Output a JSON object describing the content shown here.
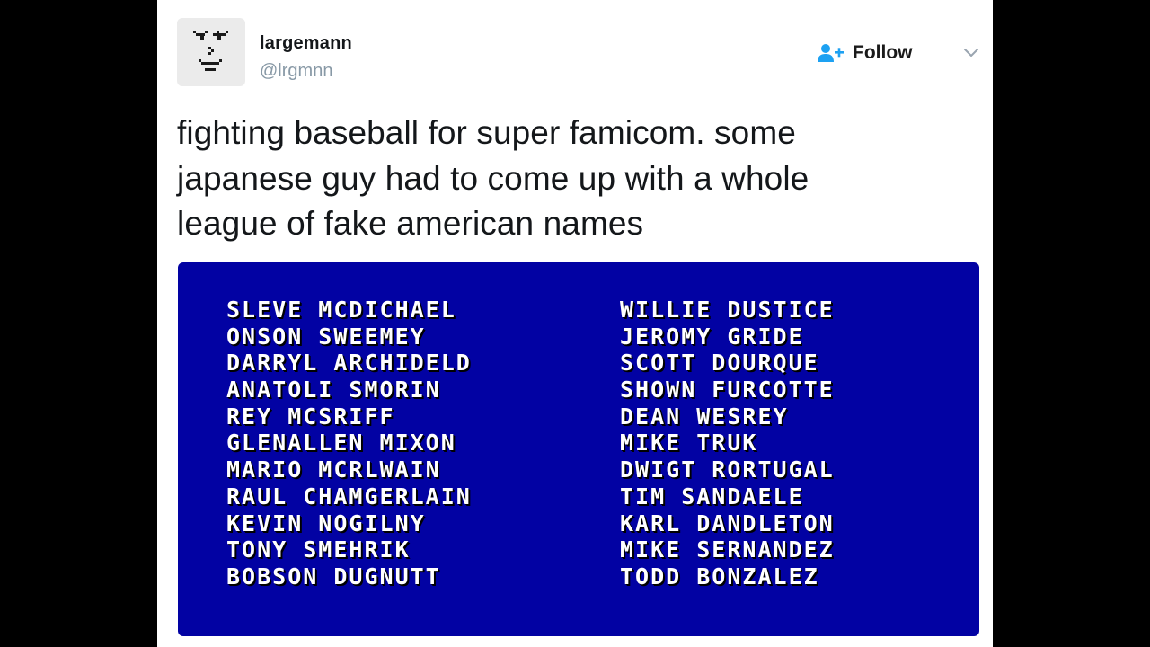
{
  "tweet": {
    "author": {
      "display_name": "largemann",
      "handle": "@lrgmnn",
      "avatar_icon": "pixel-face-avatar"
    },
    "follow_label": "Follow",
    "follow_icon": "add-user-icon",
    "menu_icon": "chevron-down-icon",
    "text": "fighting baseball for super famicom. some\njapanese guy had to come up with a whole\nleague of fake american names"
  },
  "media": {
    "background_color": "#0202a3",
    "left_column": [
      "SLEVE MCDICHAEL",
      "ONSON SWEEMEY",
      "DARRYL ARCHIDELD",
      "ANATOLI SMORIN",
      "REY MCSRIFF",
      "GLENALLEN MIXON",
      "MARIO MCRLWAIN",
      "RAUL CHAMGERLAIN",
      "KEVIN NOGILNY",
      "TONY SMEHRIK",
      "BOBSON DUGNUTT"
    ],
    "right_column": [
      "WILLIE DUSTICE",
      "JEROMY GRIDE",
      "SCOTT DOURQUE",
      "SHOWN FURCOTTE",
      "DEAN WESREY",
      "MIKE TRUK",
      "DWIGT RORTUGAL",
      "TIM SANDAELE",
      "KARL DANDLETON",
      "MIKE SERNANDEZ",
      "TODD BONZALEZ"
    ]
  },
  "colors": {
    "accent": "#1da1f2",
    "handle": "#8899a6",
    "text": "#14171a"
  }
}
